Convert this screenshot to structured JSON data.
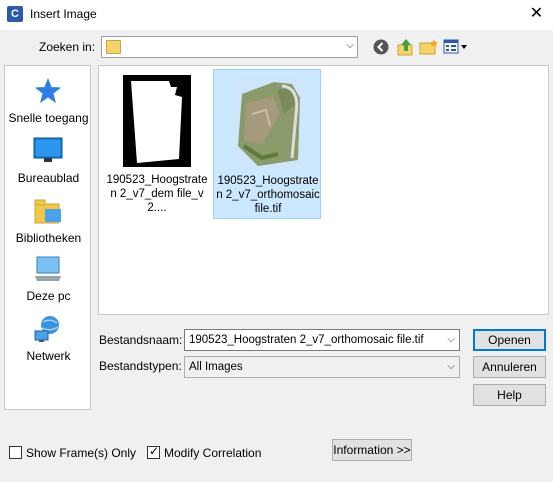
{
  "window": {
    "title": "Insert Image",
    "close_symbol": "✕"
  },
  "lookin": {
    "label": "Zoeken in:",
    "value": ""
  },
  "sidebar": {
    "items": [
      {
        "label": "Snelle toegang",
        "icon": "star-icon"
      },
      {
        "label": "Bureaublad",
        "icon": "desktop-icon"
      },
      {
        "label": "Bibliotheken",
        "icon": "library-icon"
      },
      {
        "label": "Deze pc",
        "icon": "computer-icon"
      },
      {
        "label": "Netwerk",
        "icon": "network-icon"
      }
    ]
  },
  "files": [
    {
      "name": "190523_Hoogstraten 2_v7_dem file_v2....",
      "selected": false
    },
    {
      "name": "190523_Hoogstraten 2_v7_orthomosaic file.tif",
      "selected": true
    }
  ],
  "filename": {
    "label": "Bestandsnaam:",
    "value": "190523_Hoogstraten 2_v7_orthomosaic file.tif"
  },
  "filetype": {
    "label": "Bestandstypen:",
    "value": "All Images"
  },
  "buttons": {
    "open": "Openen",
    "cancel": "Annuleren",
    "help": "Help",
    "information": "Information >>"
  },
  "options": {
    "show_frames": {
      "label": "Show Frame(s) Only",
      "checked": false
    },
    "modify_correlation": {
      "label": "Modify Correlation",
      "checked": true
    }
  },
  "colors": {
    "accent": "#0078d7",
    "selection": "#cce8ff",
    "folder": "#f3d36a"
  }
}
